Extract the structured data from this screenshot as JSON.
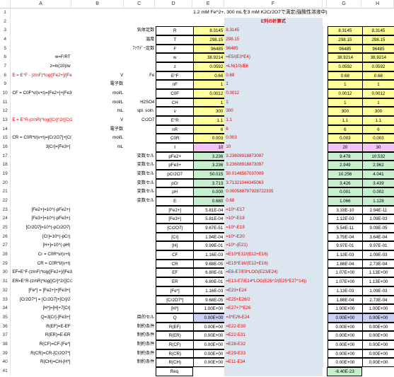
{
  "columns": [
    "A",
    "B",
    "C",
    "D",
    "E",
    "F",
    "G",
    "H"
  ],
  "colors": {
    "yellow": "#ffff99",
    "green": "#c6efce",
    "pink": "#f4c2f4",
    "lavender": "#cdd0f5",
    "blue": "#dce6f1",
    "red": "#e00000"
  },
  "rows": [
    {
      "n": "1",
      "E": "1.2 mM Fe^2+, 300 mLを3 mM K2Cr2O7で滴定(強酸性溶液中)"
    },
    {
      "n": "2",
      "F": "E列の計算式"
    },
    {
      "n": "3",
      "C": "気体定数",
      "D": "R",
      "E": "8.3145",
      "F": "8.3145",
      "G": "8.3145",
      "H": "8.3145"
    },
    {
      "n": "4",
      "C": "温度",
      "D": "T",
      "E": "298.15",
      "F": "298.15",
      "G": "298.15",
      "H": "298.15"
    },
    {
      "n": "5",
      "C": "ﾌｧﾗﾃﾞｰ定数",
      "D": "F",
      "E": "96485",
      "F": "96485",
      "G": "96485",
      "H": "96485"
    },
    {
      "n": "6",
      "A": "w=F/RT",
      "D": "w",
      "E": "38.9214",
      "F": "=E5/(E3*E4)",
      "G": "38.9214",
      "H": "38.9214"
    },
    {
      "n": "7",
      "A": "z=ln(10)/w",
      "D": "z",
      "E": "0.0592",
      "F": "=LN(10)/E6",
      "G": "0.0592",
      "H": "0.0592"
    },
    {
      "n": "8",
      "A": "E = E°F - (z/nF)*log([Fe2+]/[Fe3+])",
      "B": "V",
      "C": "Fe",
      "D": "E°F",
      "E": "0.68",
      "F": "0.68",
      "G": "0.68",
      "H": "0.68"
    },
    {
      "n": "9",
      "B": "電子数",
      "D": "nF",
      "E": "1",
      "F": "1",
      "G": "1",
      "H": "1"
    },
    {
      "n": "10",
      "B": "mol/L",
      "A": "CF = C0F*v/(v+t)=[Fe2+]+[Fe3+]",
      "D": "C0F",
      "E": "0.0012",
      "F": "0.0012",
      "G": "0.0012",
      "H": "0.0012"
    },
    {
      "n": "11",
      "B": "mol/L",
      "C": "H2SO4",
      "D": "CH",
      "E": "1",
      "F": "1",
      "G": "1",
      "H": "1"
    },
    {
      "n": "12",
      "B": "mL",
      "C": "spl. soln.",
      "D": "v",
      "E": "300",
      "F": "300",
      "G": "300",
      "H": "300"
    },
    {
      "n": "13",
      "A": "E = E°R-(z/nR)*log([Cr]^2/([Cr2O7][H]^14))",
      "B": "V",
      "C": "Cr2O7",
      "D": "E°R",
      "E": "1.1",
      "F": "1.1",
      "G": "1.1",
      "H": "1.1"
    },
    {
      "n": "14",
      "B": "電子数",
      "D": "nR",
      "E": "6",
      "F": "6",
      "G": "6",
      "H": "6"
    },
    {
      "n": "15",
      "A": "CR = C0R*t/(v+t)=[Cr2O7]+[Cr]/2",
      "B": "mol/L",
      "D": "C0R",
      "E": "0.003",
      "F": "0.003",
      "G": "0.003",
      "H": "0.003"
    },
    {
      "n": "16",
      "A": "3[Cr]=[Fe3+]",
      "B": "mL",
      "D": "t",
      "E": "10",
      "F": "10",
      "G": "20",
      "H": "30"
    },
    {
      "n": "17",
      "C": "変数セル",
      "D": "pFe2+",
      "E": "3.236",
      "F": "3.23608918873097",
      "G": "9.478",
      "H": "10.532"
    },
    {
      "n": "18",
      "C": "変数セル",
      "D": "pFe3+",
      "E": "3.236",
      "F": "3.23608918873097",
      "G": "2.949",
      "H": "2.962"
    },
    {
      "n": "19",
      "C": "変数セル",
      "D": "pCr2O7",
      "E": "50.015",
      "F": "50.0146567037009",
      "G": "10.256",
      "H": "4.041"
    },
    {
      "n": "20",
      "C": "変数セル",
      "D": "pCr",
      "E": "3.713",
      "F": "3.71321044345063",
      "G": "3.426",
      "H": "3.439"
    },
    {
      "n": "21",
      "C": "変数セル",
      "D": "pH",
      "E": "0.000",
      "F": "0.000588797928722335",
      "G": "0.001",
      "H": "0.002"
    },
    {
      "n": "22",
      "C": "変数セル",
      "D": "E",
      "E": "0.680",
      "F": "0.68",
      "G": "1.066",
      "H": "1.128"
    },
    {
      "n": "23",
      "A": "[Fe2+]=10^(-pFe2+)",
      "D": "[Fe2+]",
      "E": "5.81E-04",
      "F": "=10^-E17",
      "G": "3.33E-10",
      "H": "2.94E-11"
    },
    {
      "n": "24",
      "A": "[Fe3+]=10^(-pFe3+)",
      "D": "[Fe3+]",
      "E": "5.81E-04",
      "F": "=10^-E18",
      "G": "1.12E-03",
      "H": "1.09E-03"
    },
    {
      "n": "25",
      "A": "[Cr2O7]=10^(-pCr2O7)",
      "D": "[Cr2O7]",
      "E": "9.67E-51",
      "F": "=10^-E19",
      "G": "5.54E-11",
      "H": "9.09E-05"
    },
    {
      "n": "26",
      "A": "[Cr]=10^(-pCr)",
      "D": "[Cr]",
      "E": "1.94E-04",
      "F": "=10^-E20",
      "G": "3.75E-04",
      "H": "3.64E-04"
    },
    {
      "n": "27",
      "A": "[H+]=10^(-pH)",
      "D": "[H]",
      "E": "9.99E-01",
      "F": "=10^-(E21)",
      "G": "9.97E-01",
      "H": "9.97E-01"
    },
    {
      "n": "28",
      "A": "Cr = C0R*v/(v+t)",
      "D": "CF",
      "E": "1.16E-03",
      "F": "=E10*E12/(E12+E16)",
      "G": "1.13E-03",
      "H": "1.09E-03"
    },
    {
      "n": "29",
      "A": "CR = C0R*t/(v+t)",
      "D": "CR",
      "E": "9.68E-05",
      "F": "=E15*E16/(E12+E16)",
      "G": "1.88E-04",
      "H": "2.73E-04"
    },
    {
      "n": "30",
      "A": "EF=E°F-(z/nF)*log([Fe2+]/[Fe3+])",
      "D": "EF",
      "E": "6.80E-01",
      "F": "=E8-E7/E9*LOG(E23/E24)",
      "G": "1.07E+00",
      "H": "1.13E+00"
    },
    {
      "n": "31",
      "A": "ER=E°R-(z/nR)*log([Cr]^2/([Cr2O7][H]^14))",
      "D": "ER",
      "E": "6.80E-01",
      "F": "=E13-E7/E14*LOG(E26^2/(E25*E27^14))",
      "G": "1.07E+00",
      "H": "1.13E+00"
    },
    {
      "n": "32",
      "A": "[Fe*] = [Fe2+]+[Fe3+]",
      "D": "[Fe*]",
      "E": "1.16E-03",
      "F": "=E23+E24",
      "G": "1.13E-03",
      "H": "1.09E-03"
    },
    {
      "n": "33",
      "A": "[Cr2O7*] = [Cr2O7]+[Cr]/2",
      "D": "[Cr2O7*]",
      "E": "9.68E-05",
      "F": "=E25+E26/2",
      "G": "1.88E-04",
      "H": "2.73E-04"
    },
    {
      "n": "34",
      "A": "[H*]=[H]+7[Cr]",
      "D": "[H*]",
      "E": "1.00E+00",
      "F": "=E27+7*E26",
      "G": "1.00E+00",
      "H": "1.00E+00"
    },
    {
      "n": "35",
      "A": "Q=3[Cr]-[Fe3+]",
      "C": "目的セル",
      "D": "Q",
      "E": "0.00E+00",
      "F": "=3*E26-E24",
      "G": "0.00E+00",
      "H": "0.00E+00"
    },
    {
      "n": "36",
      "A": "R(EF)=E-EF",
      "C": "制約条件",
      "D": "R(EF)",
      "E": "0.00E+00",
      "F": "=E22-E30",
      "G": "0.00E+00",
      "H": "0.00E+00"
    },
    {
      "n": "37",
      "A": "R(ER)=E-ER",
      "C": "制約条件",
      "D": "R(ER)",
      "E": "0.00E+00",
      "F": "=E22-E31",
      "G": "0.00E+00",
      "H": "0.00E+00"
    },
    {
      "n": "38",
      "A": "R(CF)=CF-[Fe*]",
      "C": "制約条件",
      "D": "R(CF)",
      "E": "0.00E+00",
      "F": "=E28-E32",
      "G": "0.00E+00",
      "H": "0.00E+00"
    },
    {
      "n": "39",
      "A": "R(CR)=CR-[Cr2O7*]",
      "C": "制約条件",
      "D": "R(CR)",
      "E": "0.00E+00",
      "F": "=E29-E33",
      "G": "0.00E+00",
      "H": "0.00E+00"
    },
    {
      "n": "40",
      "A": "R(CH)=CH-[H*]",
      "C": "制約条件",
      "D": "R(CH)",
      "E": "0.00E+00",
      "F": "=E11-E34",
      "G": "0.00E+00",
      "H": "0.00E+00"
    },
    {
      "n": "41",
      "D": "Req",
      "G": "-6.40E-23"
    }
  ]
}
